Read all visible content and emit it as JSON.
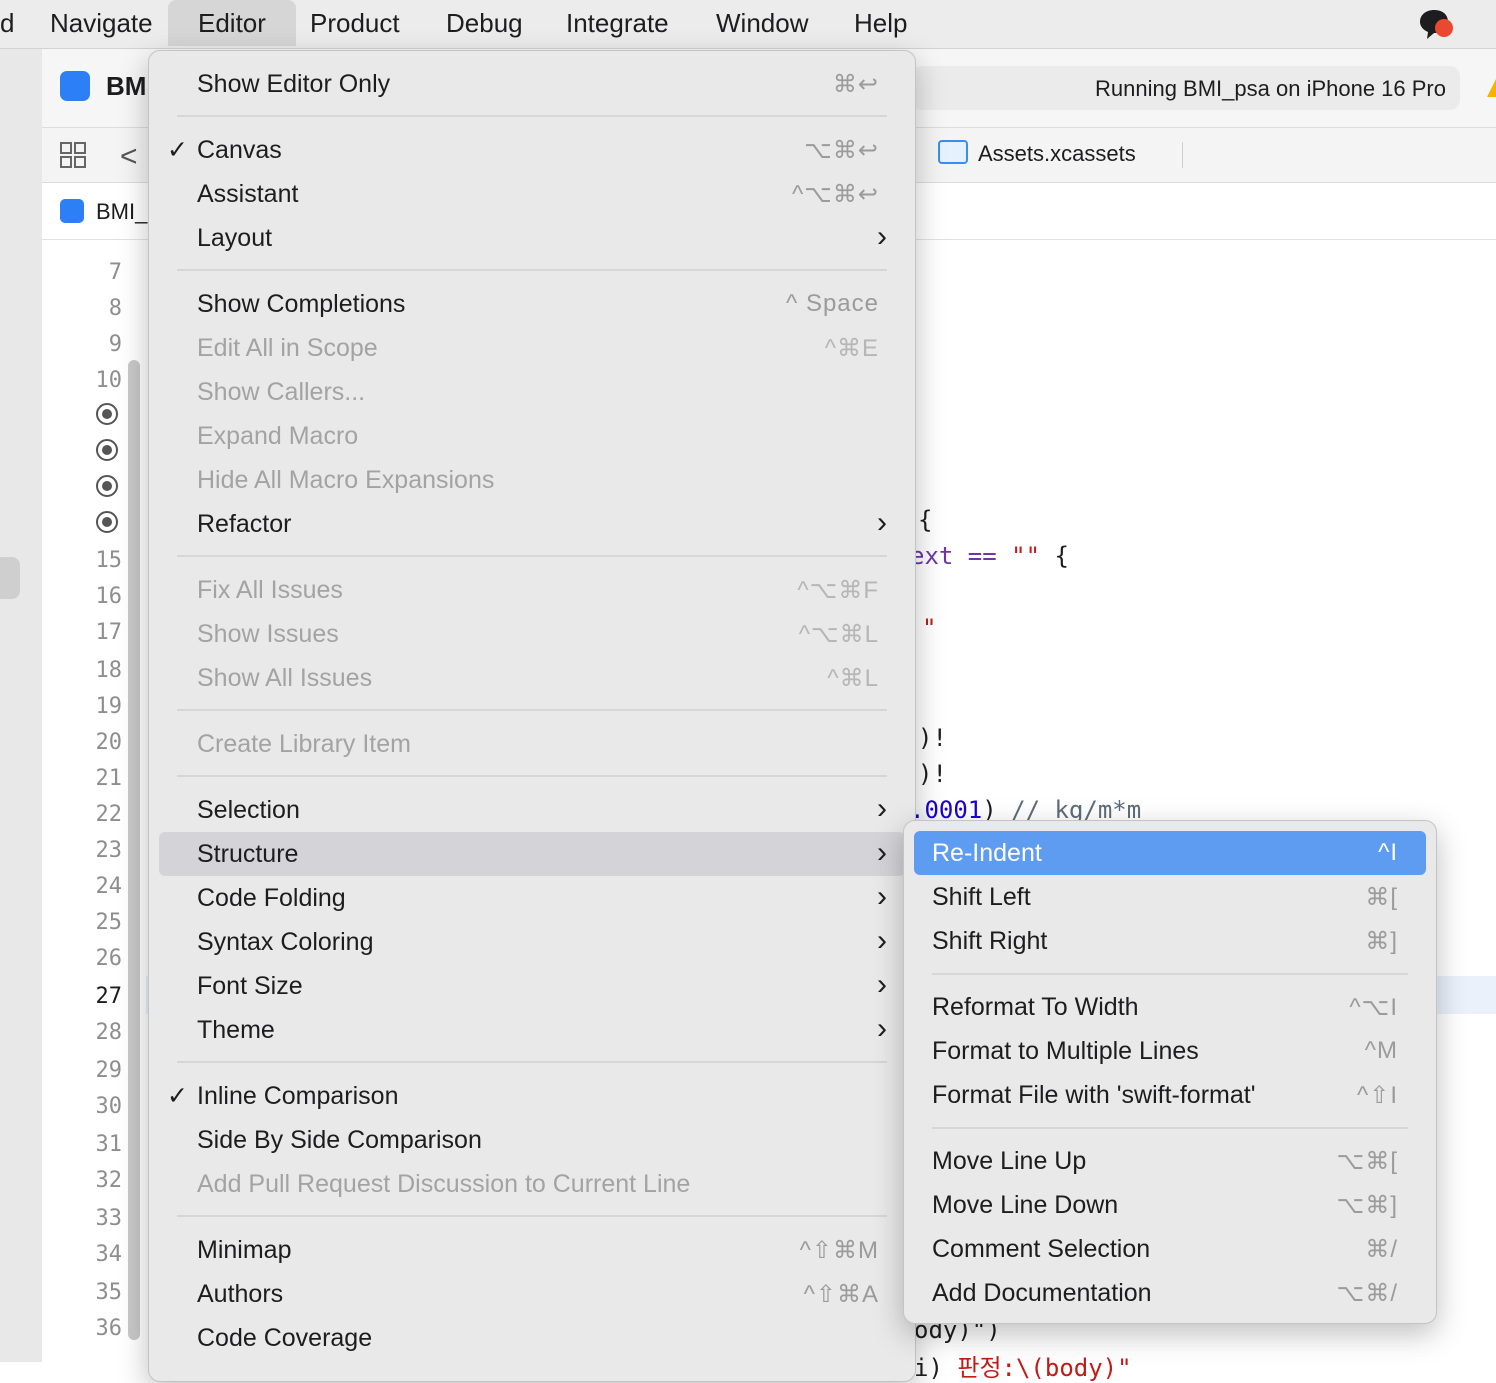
{
  "menubar": {
    "items": [
      "d",
      "Navigate",
      "Editor",
      "Product",
      "Debug",
      "Integrate",
      "Window",
      "Help"
    ]
  },
  "toolbar": {
    "project": "BM",
    "run_status": "Running BMI_psa on iPhone 16 Pro"
  },
  "tabbar": {
    "assets_tab": "Assets.xcassets"
  },
  "jumpbar": {
    "file": "BMI_"
  },
  "gutter": {
    "lines": [
      "7",
      "8",
      "9",
      "10",
      "15",
      "16",
      "17",
      "18",
      "19",
      "20",
      "21",
      "22",
      "23",
      "24",
      "25",
      "26",
      "27",
      "28",
      "29",
      "30",
      "31",
      "32",
      "33",
      "34",
      "35",
      "36"
    ],
    "current_line": "27"
  },
  "code_fragments": {
    "l1": "{",
    "l2a": "ext == ",
    "l2b": "\"\"",
    "l2c": " {",
    "l3": "\"",
    "l4": ")!",
    "l5": ")!",
    "l6a": ".0001",
    "l6b": ") ",
    "l6c": "// kg/m*m",
    "l7": "ody)\")",
    "l8a": "i) ",
    "l8b": "판정:\\(body)\""
  },
  "editor_menu": {
    "items": [
      {
        "label": "Show Editor Only",
        "shortcut": "⌘↩",
        "enabled": true
      },
      {
        "label": "Canvas",
        "shortcut": "⌥⌘↩",
        "checked": true
      },
      {
        "label": "Assistant",
        "shortcut": "^⌥⌘↩"
      },
      {
        "label": "Layout",
        "submenu": true
      },
      {
        "label": "Show Completions",
        "shortcut": "^ Space"
      },
      {
        "label": "Edit All in Scope",
        "shortcut": "^⌘E",
        "enabled": false
      },
      {
        "label": "Show Callers...",
        "enabled": false
      },
      {
        "label": "Expand Macro",
        "enabled": false
      },
      {
        "label": "Hide All Macro Expansions",
        "enabled": false
      },
      {
        "label": "Refactor",
        "submenu": true
      },
      {
        "label": "Fix All Issues",
        "shortcut": "^⌥⌘F",
        "enabled": false
      },
      {
        "label": "Show Issues",
        "shortcut": "^⌥⌘L",
        "enabled": false
      },
      {
        "label": "Show All Issues",
        "shortcut": "^⌘L",
        "enabled": false
      },
      {
        "label": "Create Library Item",
        "enabled": false
      },
      {
        "label": "Selection",
        "submenu": true
      },
      {
        "label": "Structure",
        "submenu": true,
        "highlighted": true
      },
      {
        "label": "Code Folding",
        "submenu": true
      },
      {
        "label": "Syntax Coloring",
        "submenu": true
      },
      {
        "label": "Font Size",
        "submenu": true
      },
      {
        "label": "Theme",
        "submenu": true
      },
      {
        "label": "Inline Comparison",
        "checked": true
      },
      {
        "label": "Side By Side Comparison"
      },
      {
        "label": "Add Pull Request Discussion to Current Line",
        "enabled": false
      },
      {
        "label": "Minimap",
        "shortcut": "^⇧⌘M"
      },
      {
        "label": "Authors",
        "shortcut": "^⇧⌘A"
      },
      {
        "label": "Code Coverage"
      }
    ],
    "check_glyph": "✓",
    "arrow_glyph": "›"
  },
  "structure_menu": {
    "items": [
      {
        "label": "Re-Indent",
        "shortcut": "^I",
        "selected": true
      },
      {
        "label": "Shift Left",
        "shortcut": "⌘["
      },
      {
        "label": "Shift Right",
        "shortcut": "⌘]"
      },
      {
        "label": "Reformat To Width",
        "shortcut": "^⌥I"
      },
      {
        "label": "Format to Multiple Lines",
        "shortcut": "^M"
      },
      {
        "label": "Format File with 'swift-format'",
        "shortcut": "^⇧I"
      },
      {
        "label": "Move Line Up",
        "shortcut": "⌥⌘["
      },
      {
        "label": "Move Line Down",
        "shortcut": "⌥⌘]"
      },
      {
        "label": "Comment Selection",
        "shortcut": "⌘/"
      },
      {
        "label": "Add Documentation",
        "shortcut": "⌥⌘/"
      }
    ]
  },
  "colors": {
    "menu_bg": "#e9e9e9",
    "selection_blue": "#5e9cf2",
    "hover_gray": "#d4d4d8",
    "disabled_text": "#a3a3a3",
    "string_red": "#c41a16",
    "number_blue": "#1c00cf",
    "keyword_purple": "#6c36a9"
  },
  "icons": [
    "app-icon",
    "grid-icon",
    "back-chevron-icon",
    "assets-icon",
    "chat-notification-icon",
    "breakpoint-icon",
    "warning-icon"
  ]
}
